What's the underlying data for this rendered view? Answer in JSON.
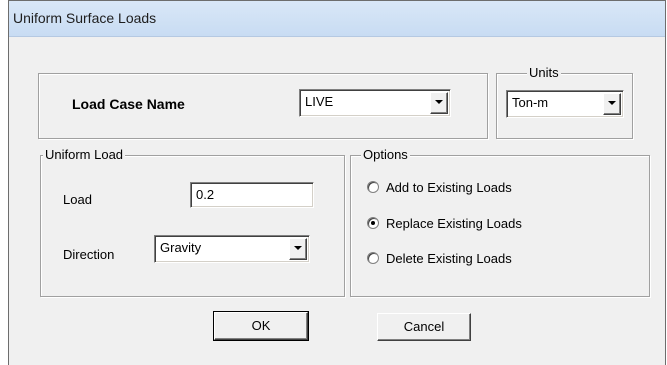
{
  "window": {
    "title": "Uniform Surface Loads"
  },
  "load_case": {
    "label": "Load Case Name",
    "value": "LIVE"
  },
  "units": {
    "legend": "Units",
    "value": "Ton-m"
  },
  "uniform_load": {
    "legend": "Uniform Load",
    "load_label": "Load",
    "load_value": "0.2",
    "direction_label": "Direction",
    "direction_value": "Gravity"
  },
  "options": {
    "legend": "Options",
    "items": [
      {
        "label": "Add to Existing Loads",
        "checked": false
      },
      {
        "label": "Replace Existing Loads",
        "checked": true
      },
      {
        "label": "Delete Existing Loads",
        "checked": false
      }
    ]
  },
  "buttons": {
    "ok": "OK",
    "cancel": "Cancel"
  }
}
